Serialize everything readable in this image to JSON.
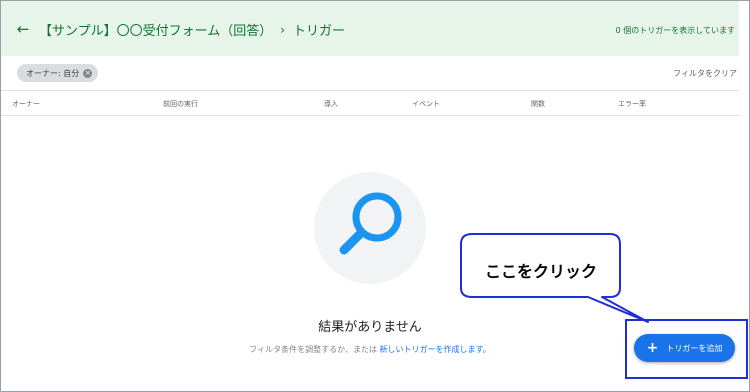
{
  "header": {
    "back_icon": "arrow-left-icon",
    "form_title": "【サンプル】〇〇受付フォーム（回答）",
    "separator": "›",
    "page_title": "トリガー",
    "status_text": "0 個のトリガーを表示しています"
  },
  "filter": {
    "chip_label": "オーナー: 自分",
    "chip_close_icon": "close-icon",
    "clear_label": "フィルタをクリア"
  },
  "table": {
    "columns": [
      "オーナー",
      "前回の実行",
      "導入",
      "イベント",
      "関数",
      "エラー率"
    ]
  },
  "empty_state": {
    "icon": "search-icon",
    "title": "結果がありません",
    "subtitle_prefix": "フィルタ条件を調整するか、または",
    "subtitle_link": "新しいトリガーを作成します。"
  },
  "fab": {
    "icon": "plus-icon",
    "label": "トリガーを追加"
  },
  "callout": {
    "text": "ここをクリック"
  },
  "colors": {
    "header_bg": "#e6f4ea",
    "header_text": "#137333",
    "accent": "#1a73e8",
    "callout_border": "#1f2fd6"
  }
}
